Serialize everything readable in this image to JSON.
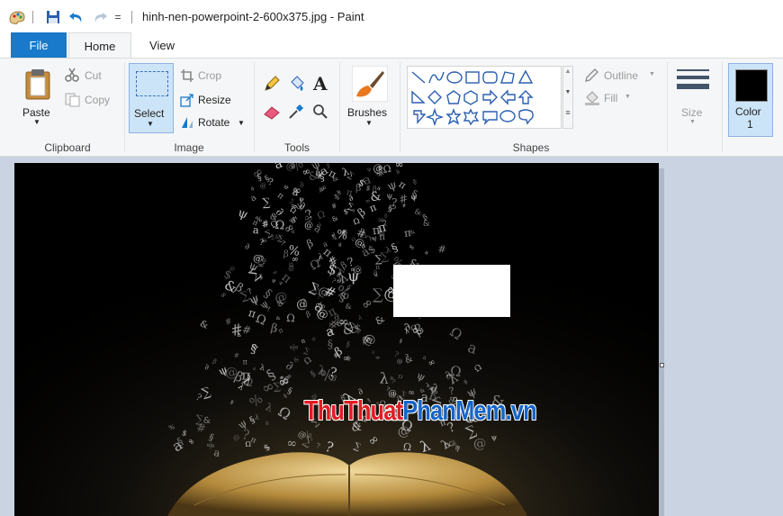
{
  "window": {
    "title": "hinh-nen-powerpoint-2-600x375.jpg - Paint",
    "qa_dropdown": "="
  },
  "tabs": {
    "file": "File",
    "home": "Home",
    "view": "View"
  },
  "ribbon": {
    "clipboard": {
      "group_label": "Clipboard",
      "paste": "Paste",
      "cut": "Cut",
      "copy": "Copy"
    },
    "image": {
      "group_label": "Image",
      "select": "Select",
      "crop": "Crop",
      "resize": "Resize",
      "rotate": "Rotate"
    },
    "tools": {
      "group_label": "Tools",
      "text_tool": "A"
    },
    "brushes": {
      "label": "Brushes"
    },
    "shapes": {
      "group_label": "Shapes",
      "outline": "Outline",
      "fill": "Fill"
    },
    "size": {
      "label": "Size"
    },
    "colors": {
      "color1_label": "Color",
      "color1_num": "1",
      "color1_value": "#000000"
    }
  },
  "canvas": {
    "watermark": {
      "part1": "ThuThuat",
      "part2": "PhanMem",
      "part3": ".vn"
    }
  },
  "colors": {
    "accent": "#1979ca",
    "selected": "#cce4f7",
    "workspace": "#c9d3e2"
  }
}
